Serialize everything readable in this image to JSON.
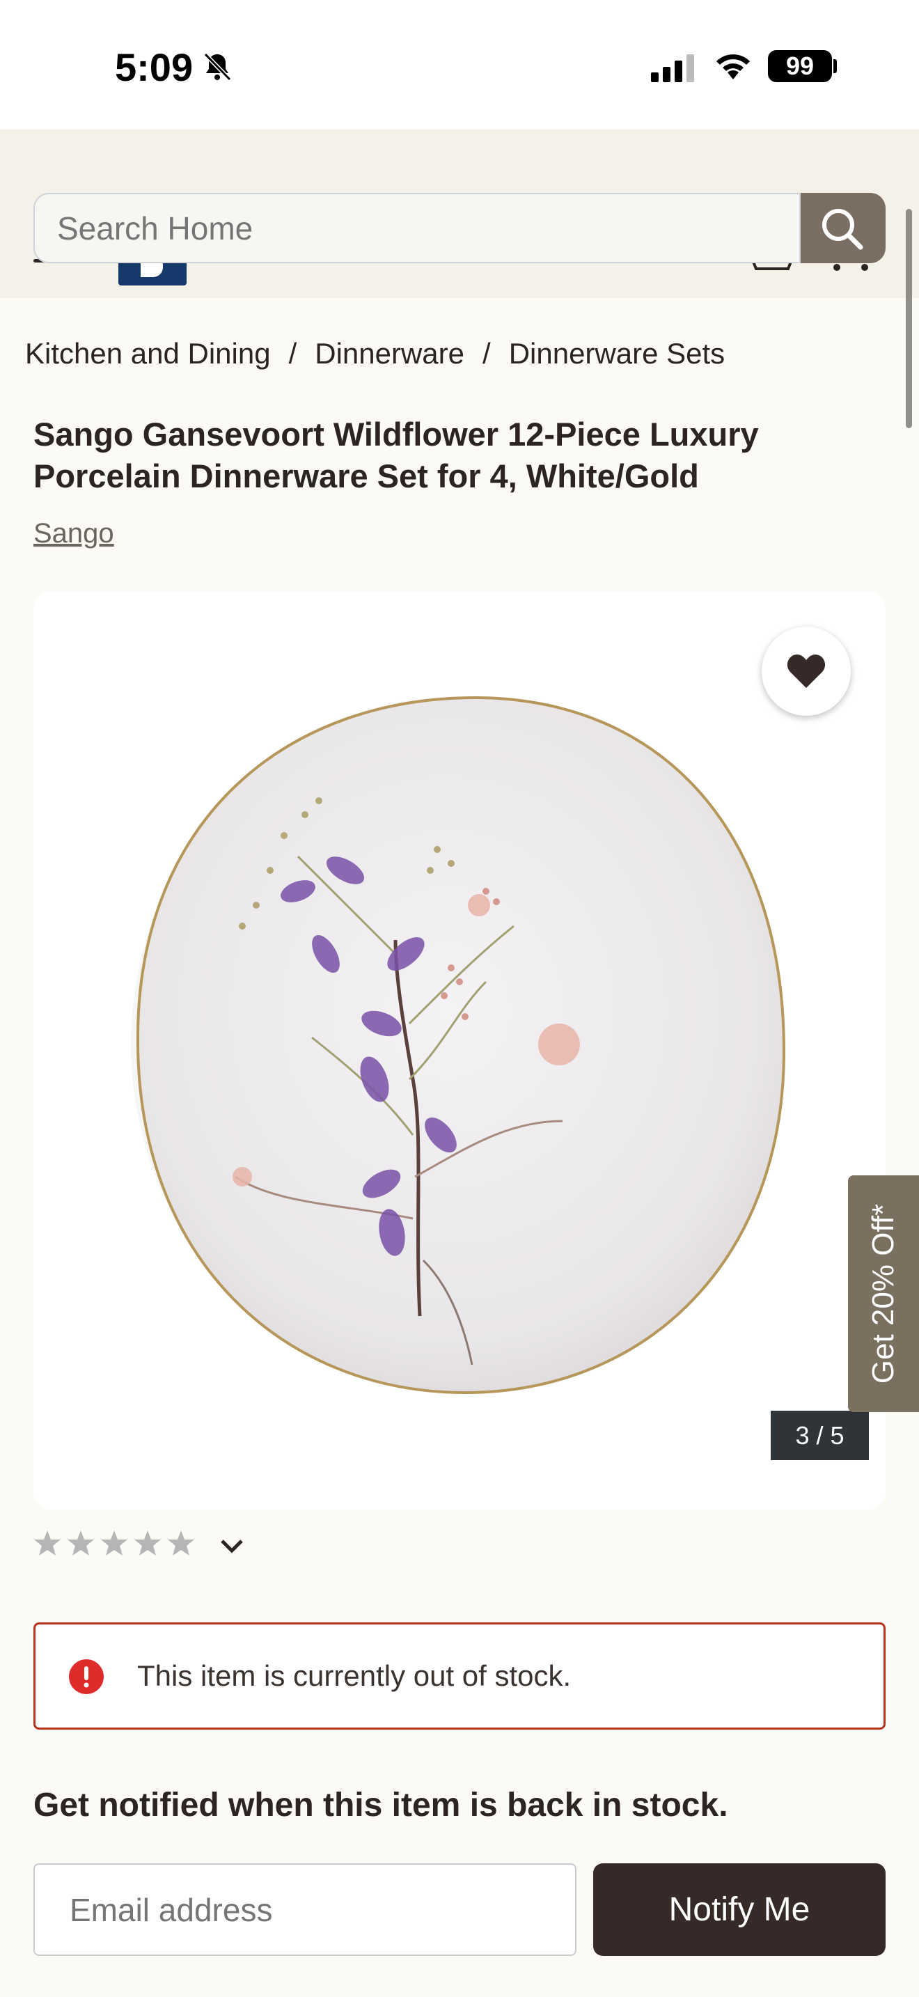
{
  "status_bar": {
    "time": "5:09",
    "battery": "99",
    "icons": [
      "bell-slash-icon",
      "cellular-signal-icon",
      "wifi-icon",
      "battery-icon"
    ]
  },
  "header": {
    "search_placeholder": "Search Home",
    "icons": [
      "menu-icon",
      "logo",
      "cart-icon",
      "more-icon",
      "search-icon"
    ]
  },
  "breadcrumb": {
    "items": [
      "Kitchen and Dining",
      "Dinnerware",
      "Dinnerware Sets"
    ],
    "separator": "/"
  },
  "product": {
    "title": "Sango Gansevoort Wildflower 12-Piece Luxury Porcelain Dinnerware Set for 4, White/Gold",
    "brand": "Sango",
    "image_counter": "3 / 5",
    "rating_stars": 0,
    "rating_max": 5
  },
  "promo": {
    "label": "Get 20% Off*"
  },
  "stock_alert": {
    "message": "This item is currently out of stock."
  },
  "notify": {
    "heading": "Get notified when this item is back in stock.",
    "email_placeholder": "Email address",
    "button_label": "Notify Me"
  },
  "colors": {
    "page_bg": "#fbfaf5",
    "header_bg": "#f3f1e8",
    "search_button": "#7a6e62",
    "alert_border": "#b3341c",
    "alert_icon": "#e02b2b",
    "notify_button": "#352a28",
    "promo_tab": "#7a7060",
    "logo": "#15396b"
  }
}
